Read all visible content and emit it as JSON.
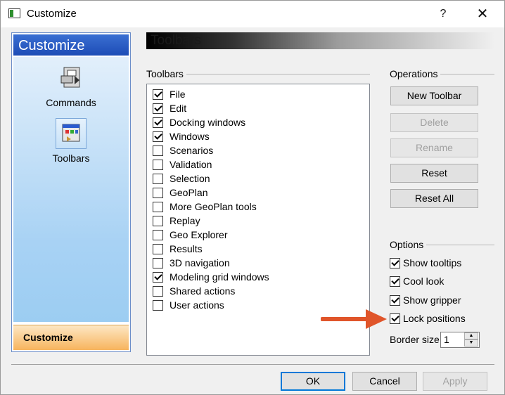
{
  "window": {
    "title": "Customize"
  },
  "titlebar": {
    "help_label": "?",
    "close_label": "✕"
  },
  "nav": {
    "header": "Customize",
    "items": [
      {
        "label": "Commands",
        "icon": "commands-icon"
      },
      {
        "label": "Toolbars",
        "icon": "toolbars-icon",
        "selected": true
      }
    ],
    "footer": "Customize"
  },
  "page": {
    "header": "Toolbars"
  },
  "toolbars": {
    "group_label": "Toolbars",
    "items": [
      {
        "label": "File",
        "checked": true
      },
      {
        "label": "Edit",
        "checked": true
      },
      {
        "label": "Docking windows",
        "checked": true
      },
      {
        "label": "Windows",
        "checked": true
      },
      {
        "label": "Scenarios",
        "checked": false
      },
      {
        "label": "Validation",
        "checked": false
      },
      {
        "label": "Selection",
        "checked": false
      },
      {
        "label": "GeoPlan",
        "checked": false
      },
      {
        "label": "More GeoPlan tools",
        "checked": false
      },
      {
        "label": "Replay",
        "checked": false
      },
      {
        "label": "Geo Explorer",
        "checked": false
      },
      {
        "label": "Results",
        "checked": false
      },
      {
        "label": "3D navigation",
        "checked": false
      },
      {
        "label": "Modeling grid windows",
        "checked": true
      },
      {
        "label": "Shared actions",
        "checked": false
      },
      {
        "label": "User actions",
        "checked": false
      }
    ]
  },
  "operations": {
    "group_label": "Operations",
    "new_toolbar": "New Toolbar",
    "delete": "Delete",
    "rename": "Rename",
    "reset": "Reset",
    "reset_all": "Reset All"
  },
  "options": {
    "group_label": "Options",
    "items": [
      {
        "label": "Show tooltips",
        "checked": true
      },
      {
        "label": "Cool look",
        "checked": true
      },
      {
        "label": "Show gripper",
        "checked": true
      },
      {
        "label": "Lock positions",
        "checked": true
      }
    ],
    "border_size_label": "Border size",
    "border_size_value": "1"
  },
  "footer": {
    "ok": "OK",
    "cancel": "Cancel",
    "apply": "Apply"
  },
  "colors": {
    "accent": "#0078d7",
    "nav_header": "#1d4cb6",
    "arrow": "#e0552a"
  }
}
